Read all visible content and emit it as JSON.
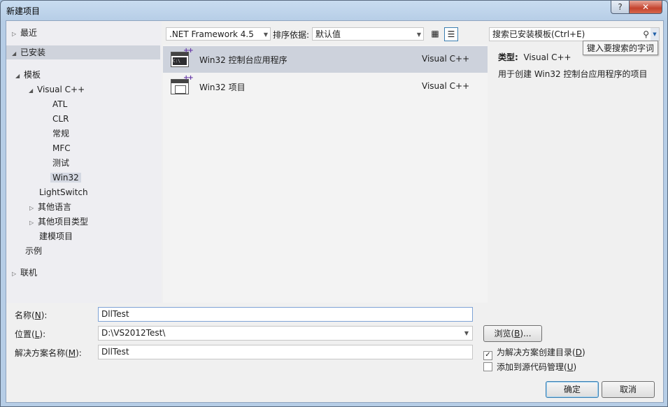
{
  "window": {
    "title": "新建项目"
  },
  "titlebar": {
    "help": "?",
    "close": "✕"
  },
  "tree": {
    "recent": "最近",
    "installed": "已安装",
    "templates": "模板",
    "visual_cpp": "Visual C++",
    "atl": "ATL",
    "clr": "CLR",
    "general": "常规",
    "mfc": "MFC",
    "test": "测试",
    "win32": "Win32",
    "lightswitch": "LightSwitch",
    "other_languages": "其他语言",
    "other_project_types": "其他项目类型",
    "modeling_projects": "建模项目",
    "samples": "示例",
    "online": "联机"
  },
  "toolbar": {
    "framework": ".NET Framework 4.5",
    "sort_label": "排序依据:",
    "sort_value": "默认值"
  },
  "templates": [
    {
      "name": "Win32 控制台应用程序",
      "lang": "Visual C++"
    },
    {
      "name": "Win32 项目",
      "lang": "Visual C++"
    }
  ],
  "search": {
    "placeholder": "搜索已安装模板(Ctrl+E)",
    "tooltip": "键入要搜索的字词"
  },
  "details": {
    "type_label": "类型:",
    "type_value": "Visual C++",
    "description": "用于创建 Win32 控制台应用程序的项目"
  },
  "form": {
    "name_label": "名称",
    "name_key": "N",
    "name_value": "DllTest",
    "location_label": "位置",
    "location_key": "L",
    "location_value": "D:\\VS2012Test\\",
    "solution_label": "解决方案名称",
    "solution_key": "M",
    "solution_value": "DllTest",
    "browse_label": "浏览",
    "browse_key": "B",
    "create_dir_label": "为解决方案创建目录",
    "create_dir_key": "D",
    "create_dir_checked": true,
    "source_control_label": "添加到源代码管理",
    "source_control_key": "U",
    "source_control_checked": false,
    "ok_label": "确定",
    "cancel_label": "取消"
  }
}
